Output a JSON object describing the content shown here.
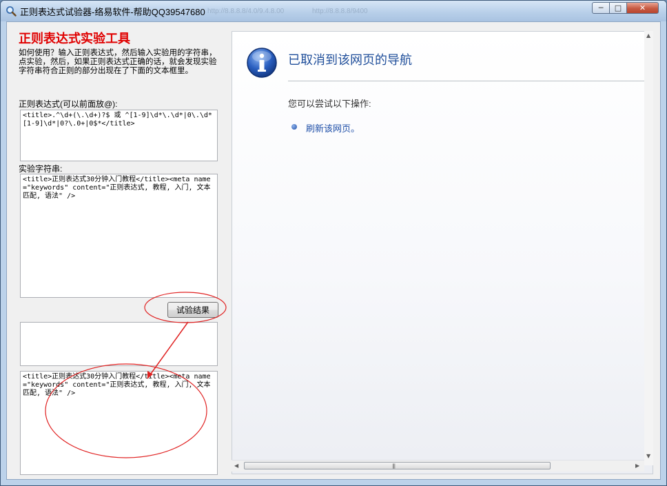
{
  "window": {
    "title": "正则表达式试验器-络易软件-帮助QQ39547680",
    "ghost_tabs": [
      "http://8.8.8.8/4.0/9.4.8.00",
      "http://8.8.8.8/9400"
    ],
    "minimize_label": "─",
    "maximize_label": "□",
    "close_label": "✕"
  },
  "left_panel": {
    "title": "正则表达式实验工具",
    "instructions": "如何使用？输入正则表达式，然后输入实验用的字符串，点实验，然后，如果正则表达式正确的话，就会发现实验字符串符合正则的部分出现在了下面的文本框里。",
    "regex_label": "正则表达式(可以前面放@):",
    "regex_value": "<title>.^\\d+(\\.\\d+)?$ 或 ^[1-9]\\d*\\.\\d*|0\\.\\d*[1-9]\\d*|0?\\.0+|0$*</title>",
    "test_string_label": "实验字符串:",
    "test_string_value": "<title>正则表达式30分钟入门教程</title><meta name=\"keywords\" content=\"正则表达式, 教程, 入门, 文本匹配, 语法\" />",
    "test_button_label": "试验结果",
    "result_empty_value": "",
    "result_value": "<title>正则表达式30分钟入门教程</title><meta name=\"keywords\" content=\"正则表达式, 教程, 入门, 文本匹配, 语法\" />"
  },
  "browser": {
    "heading": "已取消到该网页的导航",
    "subheading": "您可以尝试以下操作:",
    "refresh_link": "刷新该网页。"
  },
  "colors": {
    "app_title": "#e00000",
    "link_blue": "#1f4fa8",
    "annotation_red": "#e02020"
  },
  "icons": {
    "title_icon": "magnifier-icon",
    "info_icon": "info-icon",
    "bullet_icon": "bullet-icon"
  }
}
